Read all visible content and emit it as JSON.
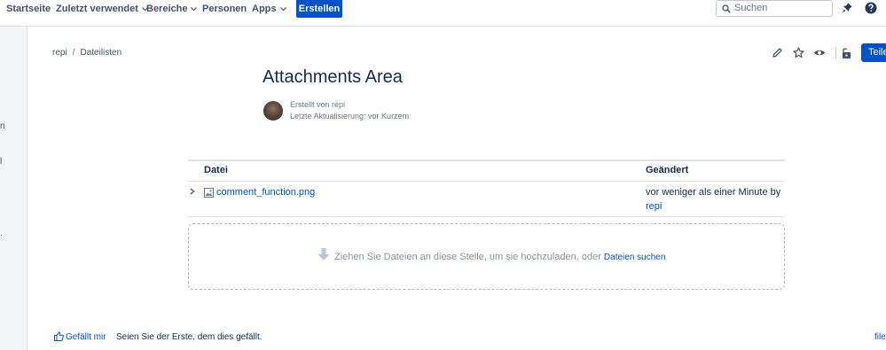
{
  "nav": {
    "items": [
      {
        "label": "Startseite"
      },
      {
        "label": "Zuletzt verwendet"
      },
      {
        "label": "Bereiche"
      },
      {
        "label": "Personen"
      },
      {
        "label": "Apps"
      }
    ],
    "create_label": "Erstellen",
    "search_placeholder": "Suchen"
  },
  "sidebar": {
    "fragments": [
      "n",
      "l",
      "."
    ]
  },
  "breadcrumb": {
    "items": [
      "repi",
      "Dateilisten"
    ]
  },
  "actions": {
    "share_label": "Teile"
  },
  "page": {
    "title": "Attachments Area",
    "created_by": "Erstellt von repi",
    "last_updated": "Letzte Aktualisierung: vor Kurzem"
  },
  "table": {
    "headers": {
      "file": "Datei",
      "modified": "Geändert"
    },
    "rows": [
      {
        "file": "comment_function.png",
        "modified": "vor weniger als einer Minute by",
        "author": "repi"
      }
    ]
  },
  "dropzone": {
    "text": "Ziehen Sie Dateien an diese Stelle, um sie hochzuladen, oder",
    "link": "Dateien suchen"
  },
  "footer": {
    "like_label": "Gefällt mir",
    "like_text": "Seien Sie der Erste, dem dies gefällt.",
    "corner_link": "file"
  },
  "colors": {
    "accent": "#0052cc",
    "text": "#172b4d",
    "subtle": "#6b778c"
  }
}
